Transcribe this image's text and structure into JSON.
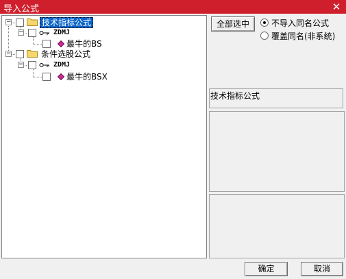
{
  "window": {
    "title": "导入公式",
    "close_glyph": "✕"
  },
  "tree": {
    "nodes": [
      {
        "label": "技术指标公式",
        "expander": "−",
        "icon": "folder-icon",
        "selected": true
      },
      {
        "label": "ZDMJ",
        "expander": "−",
        "icon": "key-icon"
      },
      {
        "label": "最牛的BS",
        "icon": "gem-icon"
      },
      {
        "label": "条件选股公式",
        "expander": "−",
        "icon": "folder-icon"
      },
      {
        "label": "ZDMJ",
        "expander": "−",
        "icon": "key-icon"
      },
      {
        "label": "最牛的BSX",
        "icon": "gem-icon"
      }
    ]
  },
  "options": {
    "select_all_label": "全部选中",
    "radio_no_import": "不导入同名公式",
    "radio_overwrite": "覆盖同名(非系统)",
    "selected": "no_import"
  },
  "info_panel": {
    "title": "技术指标公式"
  },
  "footer": {
    "ok_label": "确定",
    "cancel_label": "取消"
  },
  "colors": {
    "titlebar": "#cf1f2d",
    "selection": "#0a64c8",
    "gem": "#cc2a9a",
    "folder": "#f5d76e"
  }
}
